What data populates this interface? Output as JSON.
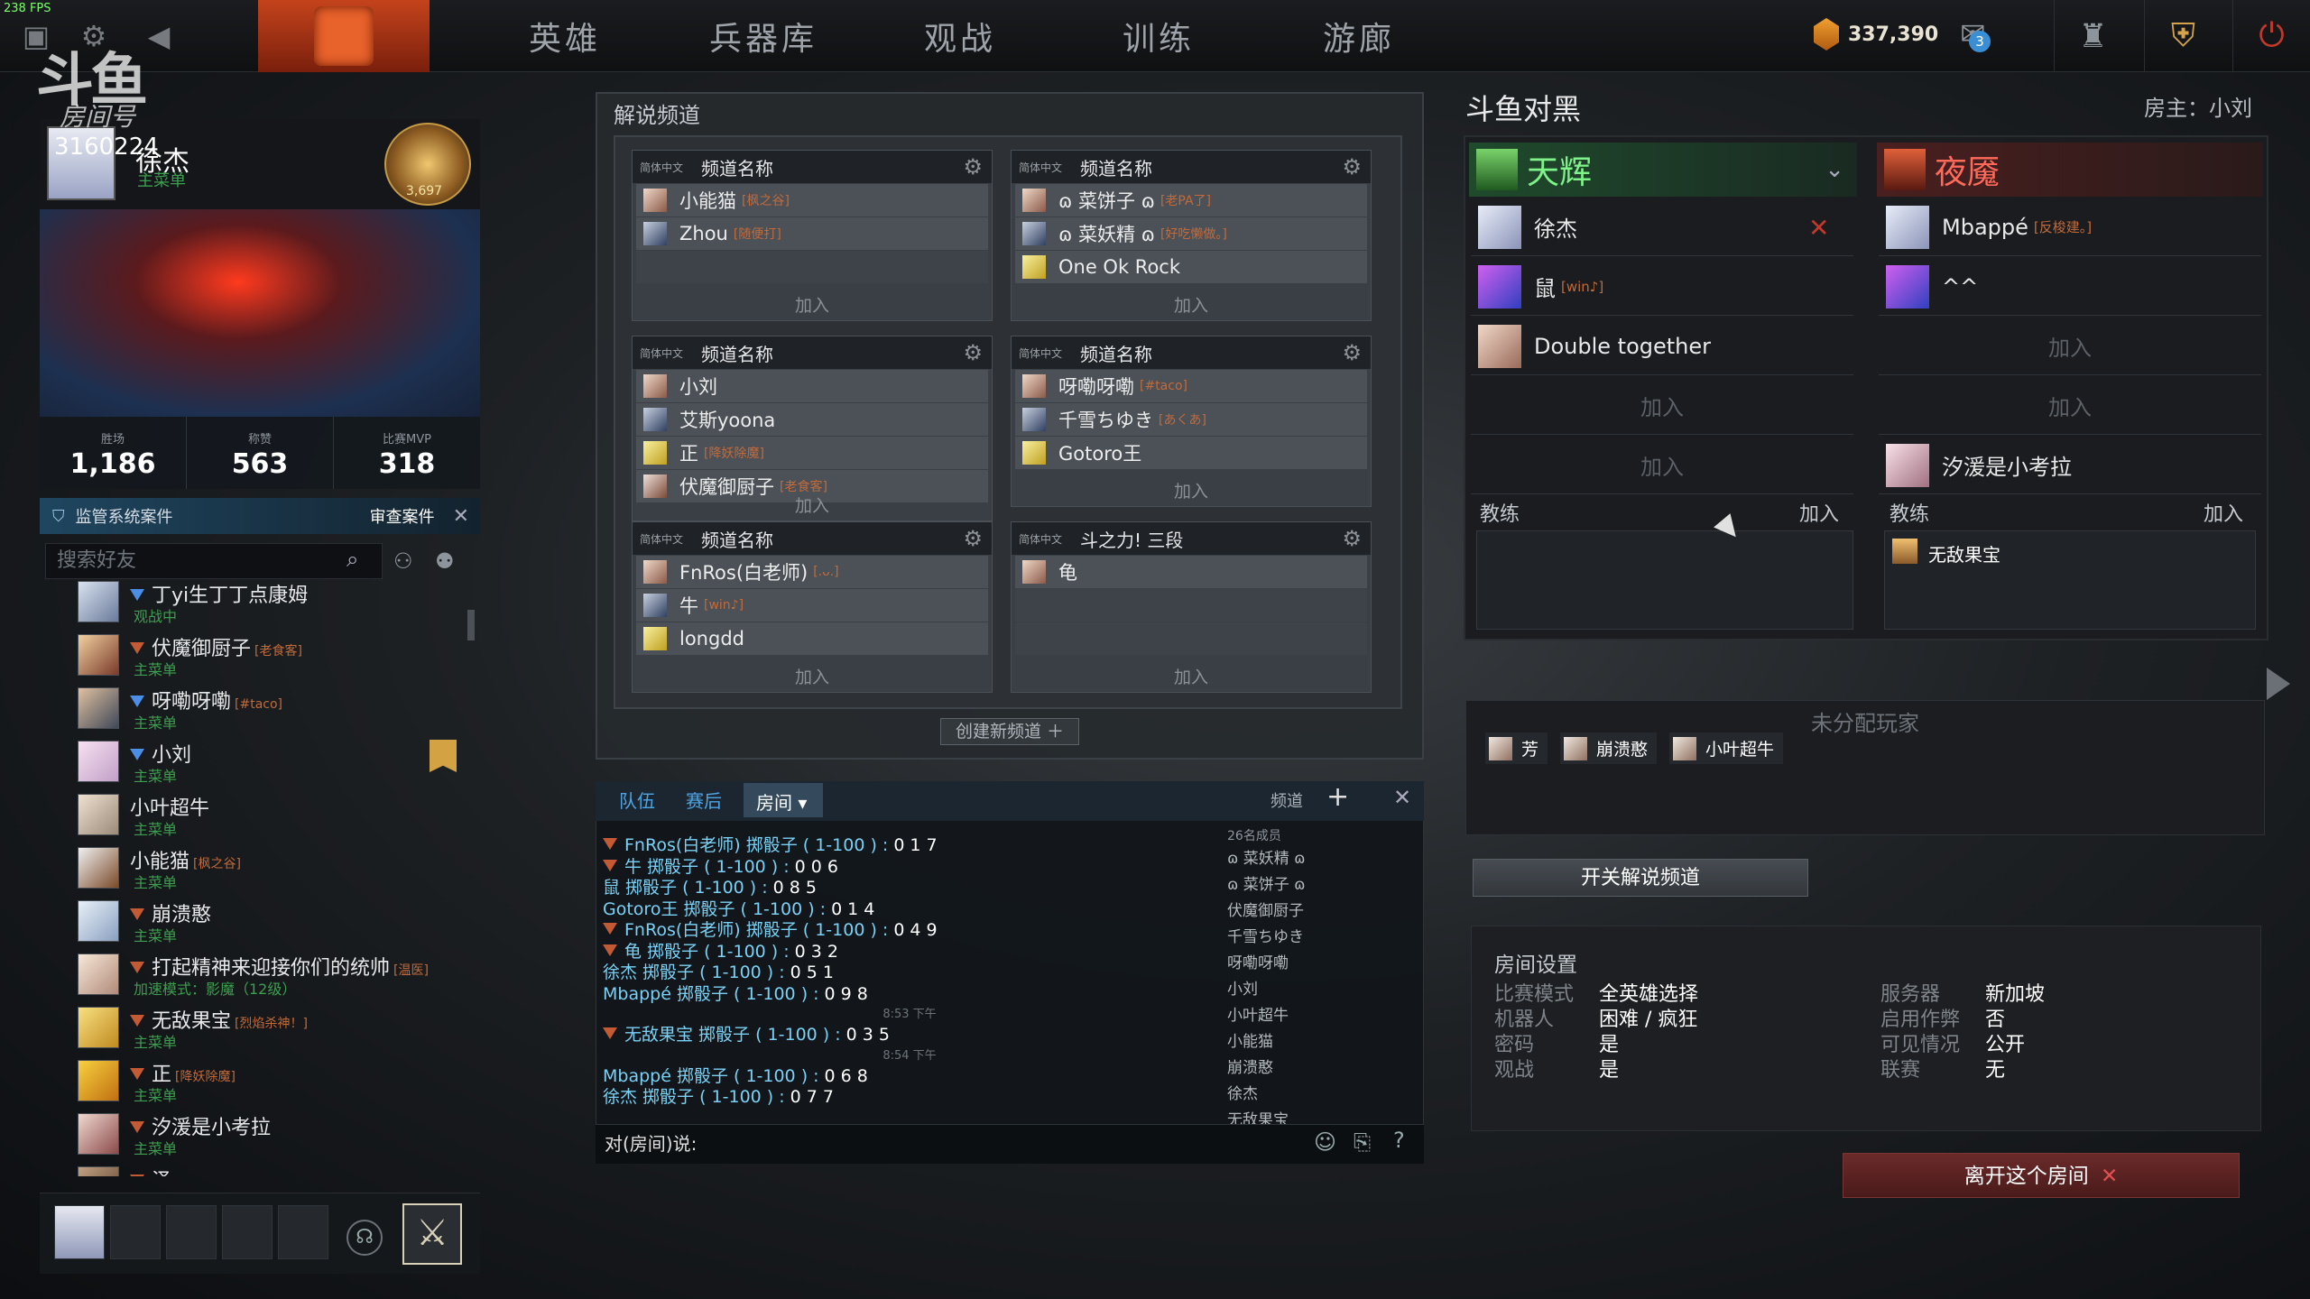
{
  "fps": "238 FPS",
  "nav": [
    "英雄",
    "兵器库",
    "观战",
    "训练",
    "游廊"
  ],
  "currency": "337,390",
  "notif_count": "3",
  "watermark": "斗鱼",
  "room_no_label": "房间号",
  "profile": {
    "room_id": "3160224",
    "name": "徐杰",
    "subtitle": "主菜单",
    "rank_number": "3,697",
    "stats": [
      {
        "label": "胜场",
        "value": "1,186"
      },
      {
        "label": "称赞",
        "value": "563"
      },
      {
        "label": "比赛MVP",
        "value": "318"
      }
    ]
  },
  "report": {
    "label": "监管系统案件",
    "button": "审查案件"
  },
  "friend_search_placeholder": "搜索好友",
  "friends": [
    {
      "name": "丁yi生丁丁点康姆",
      "tag": "",
      "status": "观战中",
      "mark": "blue"
    },
    {
      "name": "伏魔御厨子",
      "tag": "[老食客]",
      "status": "主菜单",
      "mark": "red"
    },
    {
      "name": "呀嘞呀嘞",
      "tag": "[#taco]",
      "status": "主菜单",
      "mark": "blue"
    },
    {
      "name": "小刘",
      "tag": "",
      "status": "主菜单",
      "mark": "blue"
    },
    {
      "name": "小叶超牛",
      "tag": "",
      "status": "主菜单",
      "mark": "none"
    },
    {
      "name": "小能猫",
      "tag": "[枫之谷]",
      "status": "主菜单",
      "mark": "none"
    },
    {
      "name": "崩溃憨",
      "tag": "",
      "status": "主菜单",
      "mark": "red"
    },
    {
      "name": "打起精神来迎接你们的统帅",
      "tag": "[温医]",
      "status": "加速模式：影魔（12级）",
      "mark": "red"
    },
    {
      "name": "无敌果宝",
      "tag": "[烈焰杀神！]",
      "status": "主菜单",
      "mark": "red"
    },
    {
      "name": "正",
      "tag": "[降妖除魔]",
      "status": "主菜单",
      "mark": "red"
    },
    {
      "name": "汐湲是小考拉",
      "tag": "",
      "status": "主菜单",
      "mark": "red"
    },
    {
      "name": "泽",
      "tag": "[老二次元了]",
      "status": "",
      "mark": "red"
    }
  ],
  "channels": {
    "title": "解说频道",
    "lang": "简体中文",
    "join": "加入",
    "create": "创建新频道",
    "boxes": [
      {
        "name": "频道名称",
        "members": [
          {
            "n": "小能猫",
            "t": "[枫之谷]"
          },
          {
            "n": "Zhou",
            "t": "[随便打]"
          },
          {
            "n": "",
            "t": ""
          }
        ]
      },
      {
        "name": "频道名称",
        "members": [
          {
            "n": "ɷ 菜饼子 ɷ",
            "t": "[老PA了]"
          },
          {
            "n": "ɷ 菜妖精 ɷ",
            "t": "[好吃懒做。]"
          },
          {
            "n": "One Ok Rock",
            "t": ""
          }
        ]
      },
      {
        "name": "频道名称",
        "members": [
          {
            "n": "小刘",
            "t": ""
          },
          {
            "n": "艾斯yoona",
            "t": ""
          },
          {
            "n": "正",
            "t": "[降妖除魔]"
          },
          {
            "n": "伏魔御厨子",
            "t": "[老食客]"
          }
        ]
      },
      {
        "name": "频道名称",
        "members": [
          {
            "n": "呀嘞呀嘞",
            "t": "[#taco]"
          },
          {
            "n": "千雪ちゆき",
            "t": "[あくあ]"
          },
          {
            "n": "Gotoro王",
            "t": ""
          }
        ]
      },
      {
        "name": "频道名称",
        "members": [
          {
            "n": "FnRos(白老师)",
            "t": "[.ᴗ.]"
          },
          {
            "n": "牛",
            "t": "[win♪]"
          },
          {
            "n": "longdd",
            "t": ""
          }
        ]
      },
      {
        "name": "斗之力! 三段",
        "members": [
          {
            "n": "龟",
            "t": ""
          },
          {
            "n": "",
            "t": ""
          },
          {
            "n": "",
            "t": ""
          }
        ]
      }
    ]
  },
  "chat": {
    "tabs": [
      "队伍",
      "赛后",
      "房间"
    ],
    "channel_label": "频道",
    "member_count": "26名成员",
    "input_prefix": "对(房间)说:",
    "log": [
      {
        "n": "FnRos(白老师)",
        "a": "掷骰子 ( 1-100 ) :",
        "d": "017",
        "mark": true
      },
      {
        "n": "牛",
        "a": "掷骰子 ( 1-100 ) :",
        "d": "006",
        "mark": true
      },
      {
        "n": "鼠",
        "a": "掷骰子 ( 1-100 ) :",
        "d": "085",
        "mark": false
      },
      {
        "n": "Gotoro王",
        "a": "掷骰子 ( 1-100 ) :",
        "d": "014",
        "mark": false
      },
      {
        "n": "FnRos(白老师)",
        "a": "掷骰子 ( 1-100 ) :",
        "d": "049",
        "mark": true
      },
      {
        "n": "龟",
        "a": "掷骰子 ( 1-100 ) :",
        "d": "032",
        "mark": true
      },
      {
        "n": "徐杰",
        "a": "掷骰子 ( 1-100 ) :",
        "d": "051",
        "mark": false
      },
      {
        "n": "Mbappé",
        "a": "掷骰子 ( 1-100 ) :",
        "d": "098",
        "mark": false
      },
      {
        "ts": "8:53 下午"
      },
      {
        "n": "无敌果宝",
        "a": "掷骰子 ( 1-100 ) :",
        "d": "035",
        "mark": true
      },
      {
        "ts": "8:54 下午"
      },
      {
        "n": "Mbappé",
        "a": "掷骰子 ( 1-100 ) :",
        "d": "068",
        "mark": false
      },
      {
        "n": "徐杰",
        "a": "掷骰子 ( 1-100 ) :",
        "d": "077",
        "mark": false
      }
    ],
    "members": [
      "ɷ 菜妖精 ɷ",
      "ɷ 菜饼子 ɷ",
      "伏魔御厨子",
      "千雪ちゆき",
      "呀嘞呀嘞",
      "小刘",
      "小叶超牛",
      "小能猫",
      "崩溃憨",
      "徐杰",
      "无敌果宝"
    ]
  },
  "lobby": {
    "title": "斗鱼对黑",
    "host": "房主：小刘",
    "radiant": "天辉",
    "dire": "夜魇",
    "join": "加入",
    "coach": "教练",
    "radiant_slots": [
      {
        "n": "徐杰",
        "t": ""
      },
      {
        "n": "鼠",
        "t": "[win♪]"
      },
      {
        "n": "Double together",
        "t": ""
      },
      {
        "n": "",
        "t": ""
      },
      {
        "n": "",
        "t": ""
      }
    ],
    "dire_slots": [
      {
        "n": "Mbappé",
        "t": "[反梭建。]"
      },
      {
        "n": "^^",
        "t": ""
      },
      {
        "n": "",
        "t": ""
      },
      {
        "n": "",
        "t": ""
      },
      {
        "n": "汐湲是小考拉",
        "t": ""
      }
    ],
    "dire_coach": "无敌果宝",
    "unassigned_title": "未分配玩家",
    "unassigned": [
      "芳",
      "崩溃憨",
      "小叶超牛"
    ],
    "toggle_btn": "开关解说频道",
    "settings_title": "房间设置",
    "settings": [
      {
        "k": "比赛模式",
        "v": "全英雄选择"
      },
      {
        "k": "服务器",
        "v": "新加坡"
      },
      {
        "k": "机器人",
        "v": "困难 / 疯狂"
      },
      {
        "k": "启用作弊",
        "v": "否"
      },
      {
        "k": "密码",
        "v": "是"
      },
      {
        "k": "可见情况",
        "v": "公开"
      },
      {
        "k": "观战",
        "v": "是"
      },
      {
        "k": "联赛",
        "v": "无"
      }
    ],
    "leave": "离开这个房间"
  }
}
